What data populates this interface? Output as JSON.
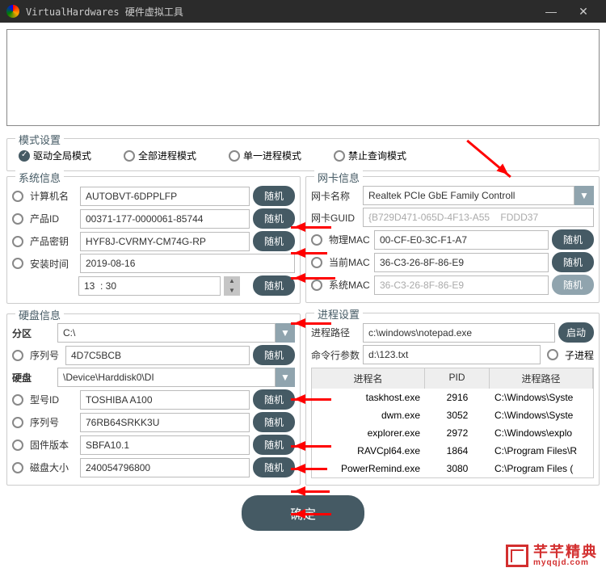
{
  "window": {
    "title": "VirtualHardwares 硬件虚拟工具"
  },
  "mode": {
    "title": "模式设置",
    "opts": [
      "驱动全局模式",
      "全部进程模式",
      "单一进程模式",
      "禁止查询模式"
    ],
    "selected": 0
  },
  "sys": {
    "title": "系统信息",
    "computer_name_label": "计算机名",
    "computer_name": "AUTOBVT-6DPPLFP",
    "product_id_label": "产品ID",
    "product_id": "00371-177-0000061-85744",
    "product_key_label": "产品密钥",
    "product_key": "HYF8J-CVRMY-CM74G-RP",
    "install_time_label": "安装时间",
    "install_date": "2019-08-16",
    "install_time": "13  : 30",
    "random": "随机"
  },
  "nic": {
    "title": "网卡信息",
    "name_label": "网卡名称",
    "name": "Realtek PCIe GbE Family Controll",
    "guid_label": "网卡GUID",
    "guid": "{B729D471-065D-4F13-A55    FDDD37",
    "phys_mac_label": "物理MAC",
    "phys_mac": "00-CF-E0-3C-F1-A7",
    "curr_mac_label": "当前MAC",
    "curr_mac": "36-C3-26-8F-86-E9",
    "sys_mac_label": "系统MAC",
    "sys_mac": "36-C3-26-8F-86-E9",
    "random": "随机"
  },
  "disk": {
    "title": "硬盘信息",
    "partition_label": "分区",
    "partition": "C:\\",
    "serial1_label": "序列号",
    "serial1": "4D7C5BCB",
    "disk_label": "硬盘",
    "disk": "\\Device\\Harddisk0\\DI",
    "model_label": "型号ID",
    "model": "TOSHIBA A100",
    "serial2_label": "序列号",
    "serial2": "76RB64SRKK3U",
    "firmware_label": "固件版本",
    "firmware": "SBFA10.1",
    "size_label": "磁盘大小",
    "size": "240054796800",
    "random": "随机"
  },
  "proc": {
    "title": "进程设置",
    "path_label": "进程路径",
    "path": "c:\\windows\\notepad.exe",
    "args_label": "命令行参数",
    "args": "d:\\123.txt",
    "launch": "启动",
    "child": "子进程",
    "headers": [
      "进程名",
      "PID",
      "进程路径"
    ],
    "rows": [
      {
        "name": "taskhost.exe",
        "pid": "2916",
        "path": "C:\\Windows\\Syste"
      },
      {
        "name": "dwm.exe",
        "pid": "3052",
        "path": "C:\\Windows\\Syste"
      },
      {
        "name": "explorer.exe",
        "pid": "2972",
        "path": "C:\\Windows\\explo"
      },
      {
        "name": "RAVCpl64.exe",
        "pid": "1864",
        "path": "C:\\Program Files\\R"
      },
      {
        "name": "PowerRemind.exe",
        "pid": "3080",
        "path": "C:\\Program Files ("
      }
    ]
  },
  "confirm": "确定",
  "watermark": {
    "brand": "芊芊精典",
    "url": "myqqjd.com"
  }
}
